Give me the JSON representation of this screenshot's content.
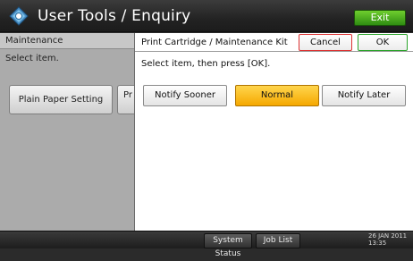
{
  "header": {
    "title": "User Tools / Enquiry",
    "exit_label": "Exit",
    "icon": "gear-diamond-icon"
  },
  "background_panel": {
    "section_label": "Maintenance",
    "prompt": "Select item.",
    "buttons": [
      "Plain Paper Setting",
      "Pr M"
    ]
  },
  "dialog": {
    "title": "Print Cartridge / Maintenance Kit",
    "cancel_label": "Cancel",
    "ok_label": "OK",
    "instruction": "Select item, then press [OK].",
    "options": [
      {
        "label": "Notify Sooner",
        "selected": false
      },
      {
        "label": "Normal",
        "selected": true
      },
      {
        "label": "Notify Later",
        "selected": false
      }
    ]
  },
  "statusbar": {
    "system_status_label": "System Status",
    "job_list_label": "Job List",
    "date": "26 JAN 2011",
    "time": "13:35"
  },
  "colors": {
    "selected_option": "#f5b300",
    "exit_button": "#3ca11a",
    "cancel_border": "#dd3333",
    "ok_border": "#2ca52c"
  }
}
